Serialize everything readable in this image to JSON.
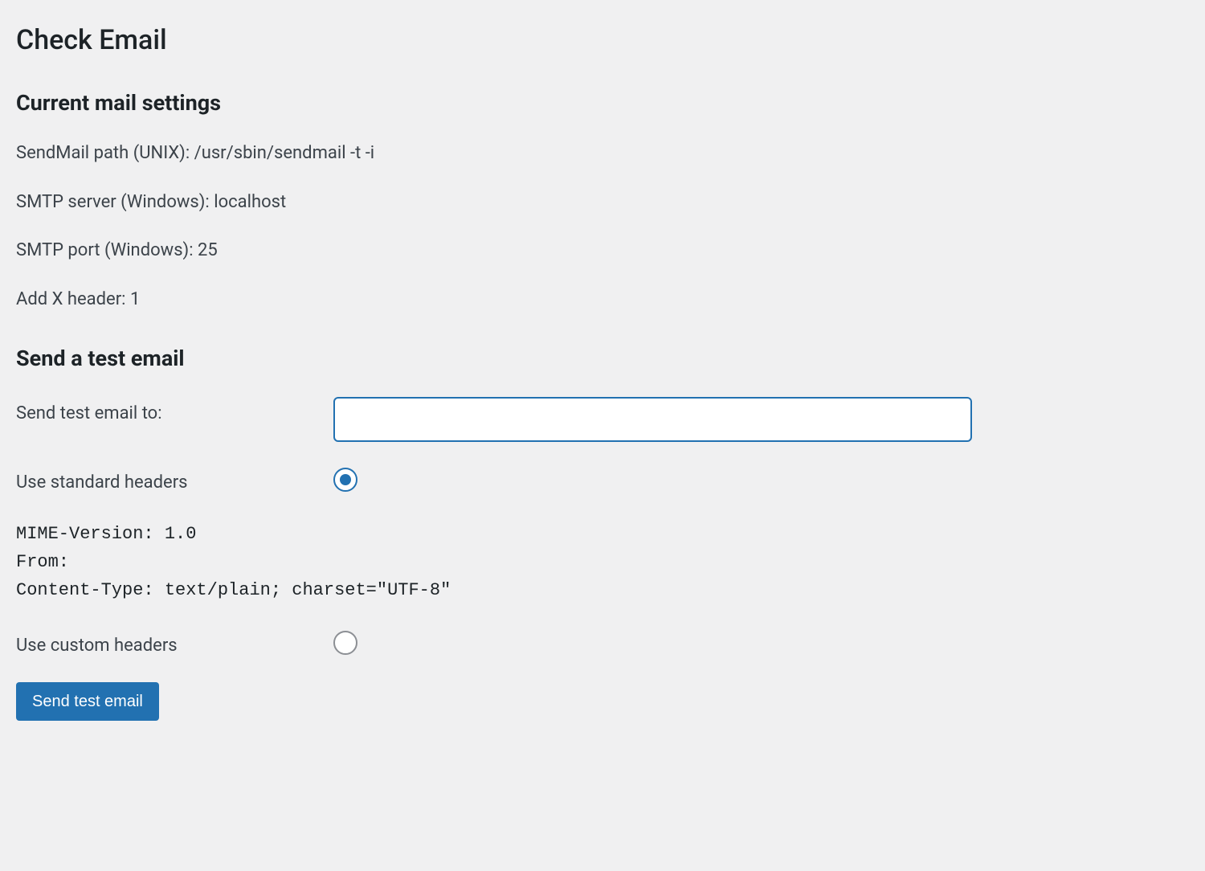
{
  "page_title": "Check Email",
  "settings": {
    "heading": "Current mail settings",
    "items": [
      {
        "label": "SendMail path (UNIX):",
        "value": "/usr/sbin/sendmail -t -i"
      },
      {
        "label": "SMTP server (Windows):",
        "value": "localhost"
      },
      {
        "label": "SMTP port (Windows):",
        "value": "25"
      },
      {
        "label": "Add X header:",
        "value": "1"
      }
    ]
  },
  "test": {
    "heading": "Send a test email",
    "send_to_label": "Send test email to:",
    "send_to_value": "",
    "use_standard_label": "Use standard headers",
    "use_custom_label": "Use custom headers",
    "standard_headers": "MIME-Version: 1.0\nFrom:\nContent-Type: text/plain; charset=\"UTF-8\"",
    "button_label": "Send test email"
  }
}
